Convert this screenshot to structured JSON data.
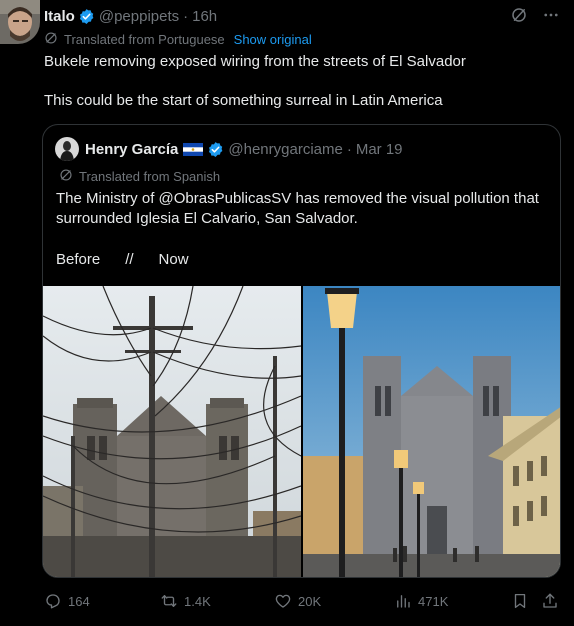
{
  "post": {
    "author_name": "Italo",
    "author_handle": "@peppipets",
    "separator": "·",
    "time": "16h",
    "translated_label": "Translated from Portuguese",
    "show_original": "Show original",
    "text_line1": "Bukele removing exposed wiring from the streets of El Salvador",
    "text_line2": "This could be the start of something surreal in Latin America"
  },
  "quote": {
    "author_name": "Henry García",
    "author_handle": "@henrygarciame",
    "separator": "·",
    "date": "Mar 19",
    "translated_label": "Translated from Spanish",
    "text": "The Ministry of @ObrasPublicasSV has removed the visual pollution that surrounded Iglesia El Calvario, San Salvador.",
    "caption": "Before      //      Now"
  },
  "actions": {
    "replies": "164",
    "reposts": "1.4K",
    "likes": "20K",
    "views": "471K"
  },
  "colors": {
    "accent": "#1d9bf0",
    "muted": "#71767b",
    "text": "#e7e9ea",
    "border": "#2f3336",
    "background": "#000000"
  },
  "icons": {
    "verified": "verified-badge-icon",
    "grok": "grok-icon",
    "more": "more-icon",
    "translate": "translate-icon",
    "flag": "el-salvador-flag-icon",
    "reply": "reply-icon",
    "repost": "repost-icon",
    "like": "like-icon",
    "views": "views-icon",
    "bookmark": "bookmark-icon",
    "share": "share-icon"
  }
}
